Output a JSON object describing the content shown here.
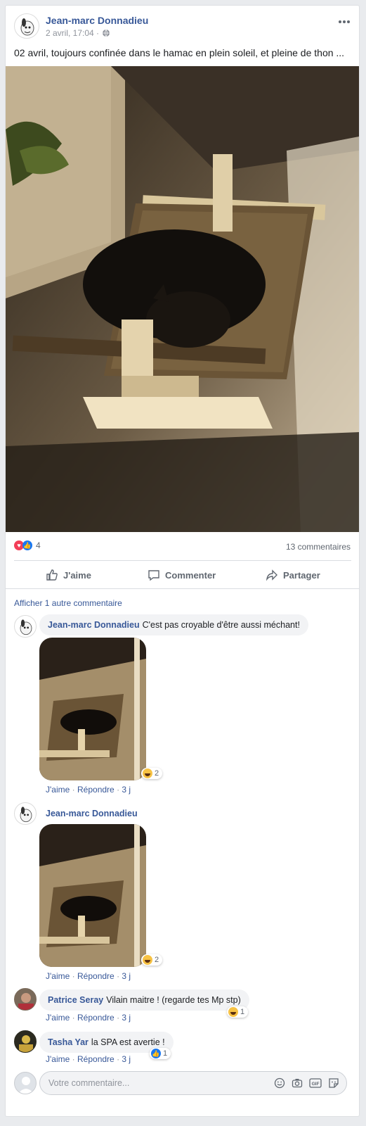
{
  "post": {
    "author": "Jean-marc Donnadieu",
    "timestamp": "2 avril, 17:04 ·",
    "privacy_icon": "globe-icon",
    "more_icon": "more-options-icon",
    "text": "02 avril, toujours confinée dans le hamac en plein soleil, et pleine de thon ..."
  },
  "reactions": {
    "count": "4",
    "comments_count": "13 commentaires"
  },
  "actions": {
    "like": "J'aime",
    "comment": "Commenter",
    "share": "Partager"
  },
  "comments_section": {
    "more_comments": "Afficher 1 autre commentaire",
    "like_label": "J'aime",
    "reply_label": "Répondre",
    "age": "3 j",
    "sep": "·",
    "items": [
      {
        "name": "Jean-marc Donnadieu",
        "text": "C'est pas croyable d'être aussi méchant!",
        "reaction_count": "2",
        "reaction": "haha"
      },
      {
        "name": "Jean-marc Donnadieu",
        "text": "",
        "reaction_count": "2",
        "reaction": "haha"
      },
      {
        "name": "Patrice Seray",
        "text": "Vilain maitre ! (regarde tes Mp stp)",
        "reaction_count": "1",
        "reaction": "haha"
      },
      {
        "name": "Tasha Yar",
        "text": "la SPA est avertie !",
        "reaction_count": "1",
        "reaction": "like"
      }
    ]
  },
  "composer": {
    "placeholder": "Votre commentaire..."
  },
  "colors": {
    "link": "#385898",
    "background": "#e9ebee",
    "like_blue": "#1877f2",
    "love_red": "#f33e58"
  }
}
